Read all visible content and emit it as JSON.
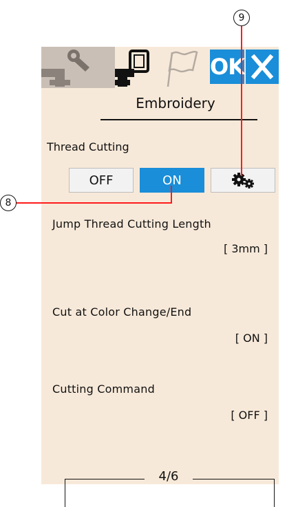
{
  "callouts": {
    "c9": "9",
    "c8": "8"
  },
  "tabs": [
    {
      "name": "utility",
      "icon": "wrench-machine-icon",
      "active": false
    },
    {
      "name": "embroidery",
      "icon": "embroidery-machine-icon",
      "active": true
    },
    {
      "name": "language",
      "icon": "flag-icon",
      "active": false
    }
  ],
  "header": {
    "ok_label": "OK",
    "close_icon": "close-icon"
  },
  "page_title": "Embroidery",
  "thread_cutting": {
    "label": "Thread Cutting",
    "off_label": "OFF",
    "on_label": "ON",
    "settings_icon": "gears-icon",
    "selected": "ON"
  },
  "settings": [
    {
      "label": "Jump Thread Cutting Length",
      "value": "[ 3mm ]"
    },
    {
      "label": "Cut at Color Change/End",
      "value": "[ ON ]"
    },
    {
      "label": "Cutting Command",
      "value": "[ OFF ]"
    }
  ],
  "pager": {
    "text": "4/6"
  },
  "colors": {
    "accent": "#1a8ed8",
    "panel": "#f7e9d9",
    "callout_line": "#ff1a1a"
  }
}
